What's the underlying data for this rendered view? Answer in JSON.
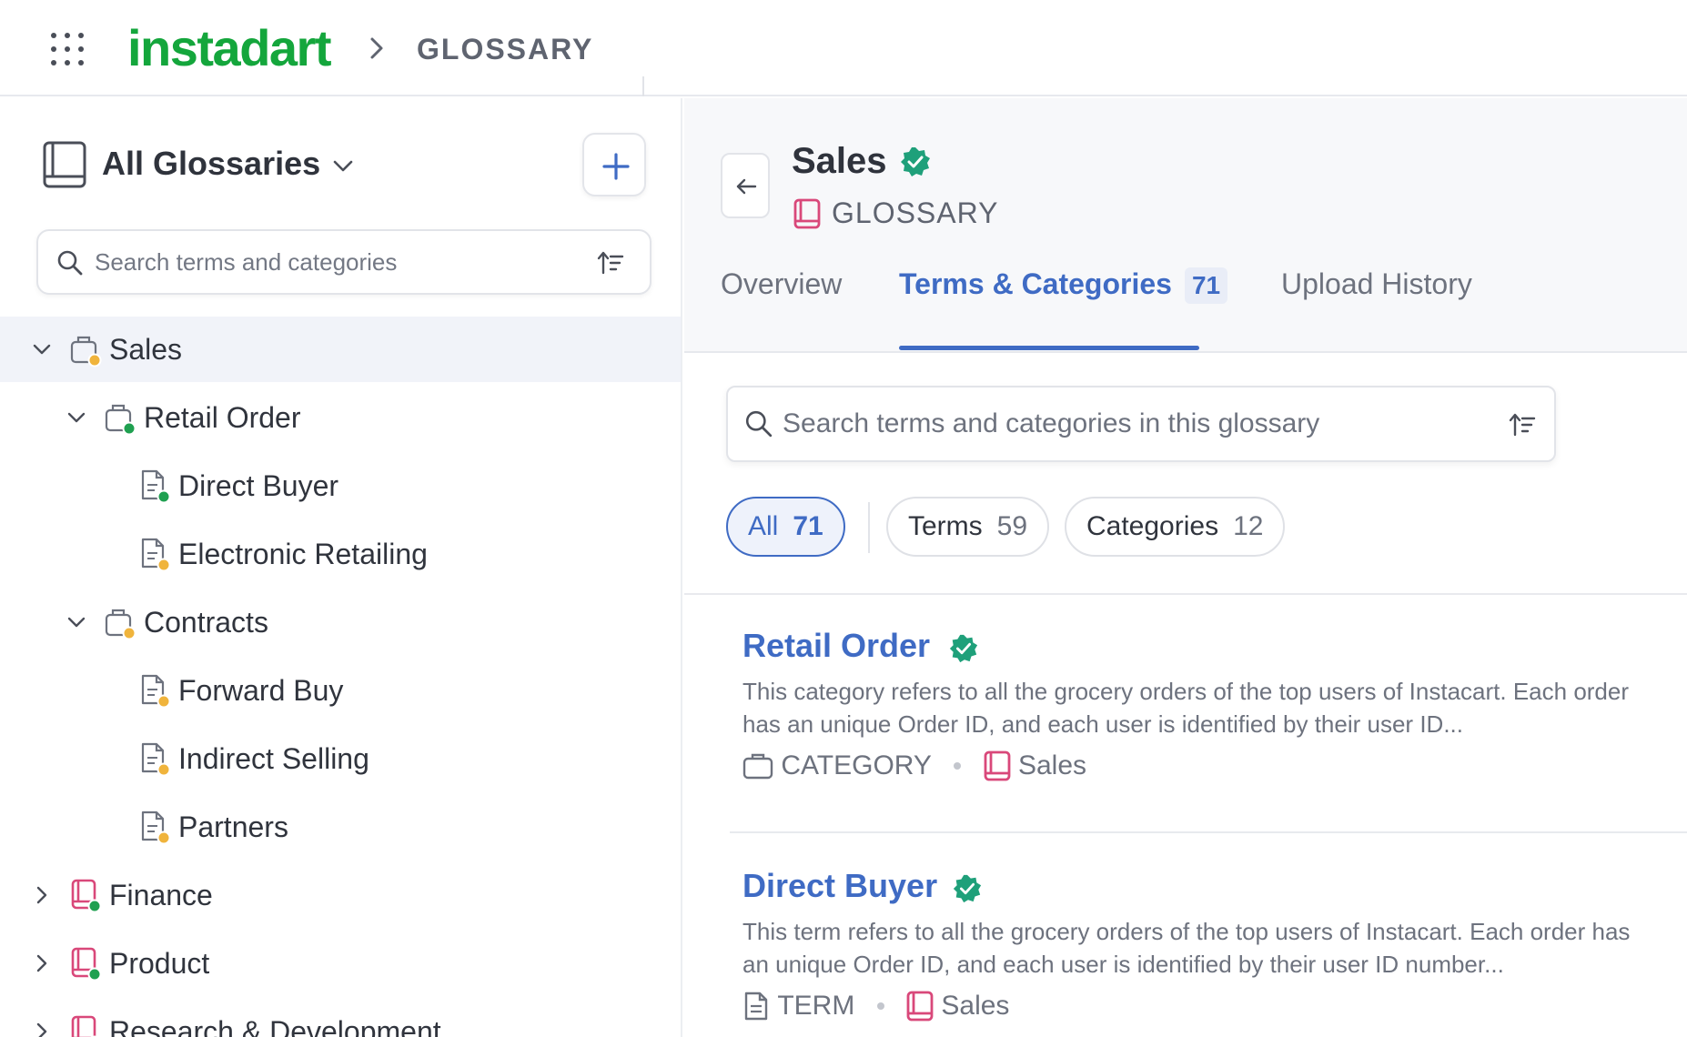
{
  "header": {
    "logo": "instadart",
    "breadcrumb": "GLOSSARY"
  },
  "sidebar": {
    "title": "All Glossaries",
    "search_placeholder": "Search terms and categories",
    "tree": [
      {
        "label": "Sales",
        "kind": "category",
        "expanded": true,
        "status_color": "#f0b43c",
        "depth": 0
      },
      {
        "label": "Retail Order",
        "kind": "category",
        "expanded": true,
        "status_color": "#1fa050",
        "depth": 1
      },
      {
        "label": "Direct Buyer",
        "kind": "term",
        "status_color": "#1fa050",
        "depth": 2
      },
      {
        "label": "Electronic Retailing",
        "kind": "term",
        "status_color": "#f0b43c",
        "depth": 2
      },
      {
        "label": "Contracts",
        "kind": "category",
        "expanded": true,
        "status_color": "#f0b43c",
        "depth": 1
      },
      {
        "label": "Forward Buy",
        "kind": "term",
        "status_color": "#f0b43c",
        "depth": 2
      },
      {
        "label": "Indirect Selling",
        "kind": "term",
        "status_color": "#f0b43c",
        "depth": 2
      },
      {
        "label": "Partners",
        "kind": "term",
        "status_color": "#f0b43c",
        "depth": 2
      },
      {
        "label": "Finance",
        "kind": "glossary",
        "expanded": false,
        "status_color": "#1fa050",
        "depth": 0
      },
      {
        "label": "Product",
        "kind": "glossary",
        "expanded": false,
        "status_color": "#1fa050",
        "depth": 0
      },
      {
        "label": "Research & Development",
        "kind": "glossary",
        "expanded": false,
        "status_color": "#1fa050",
        "depth": 0
      }
    ]
  },
  "main": {
    "title": "Sales",
    "type_label": "GLOSSARY",
    "tabs": [
      {
        "label": "Overview"
      },
      {
        "label": "Terms & Categories",
        "count": "71",
        "active": true
      },
      {
        "label": "Upload History"
      }
    ],
    "search_placeholder": "Search terms and categories in this glossary",
    "filters": [
      {
        "label": "All",
        "count": "71",
        "active": true
      },
      {
        "label": "Terms",
        "count": "59"
      },
      {
        "label": "Categories",
        "count": "12"
      }
    ],
    "items": [
      {
        "title": "Retail Order",
        "description": "This category refers to all the grocery orders of the top users of Instacart. Each order has an unique Order ID, and each user is identified by their user ID...",
        "type": "CATEGORY",
        "glossary": "Sales"
      },
      {
        "title": "Direct Buyer",
        "description": "This term refers to all the grocery orders of the top users of Instacart. Each order has an unique Order ID, and each user is identified by their user ID number...",
        "type": "TERM",
        "glossary": "Sales"
      }
    ]
  },
  "colors": {
    "brand": "#14a63c",
    "accent": "#3f6bc4",
    "verified": "#1fa07a",
    "glossary_icon": "#d9487a"
  }
}
